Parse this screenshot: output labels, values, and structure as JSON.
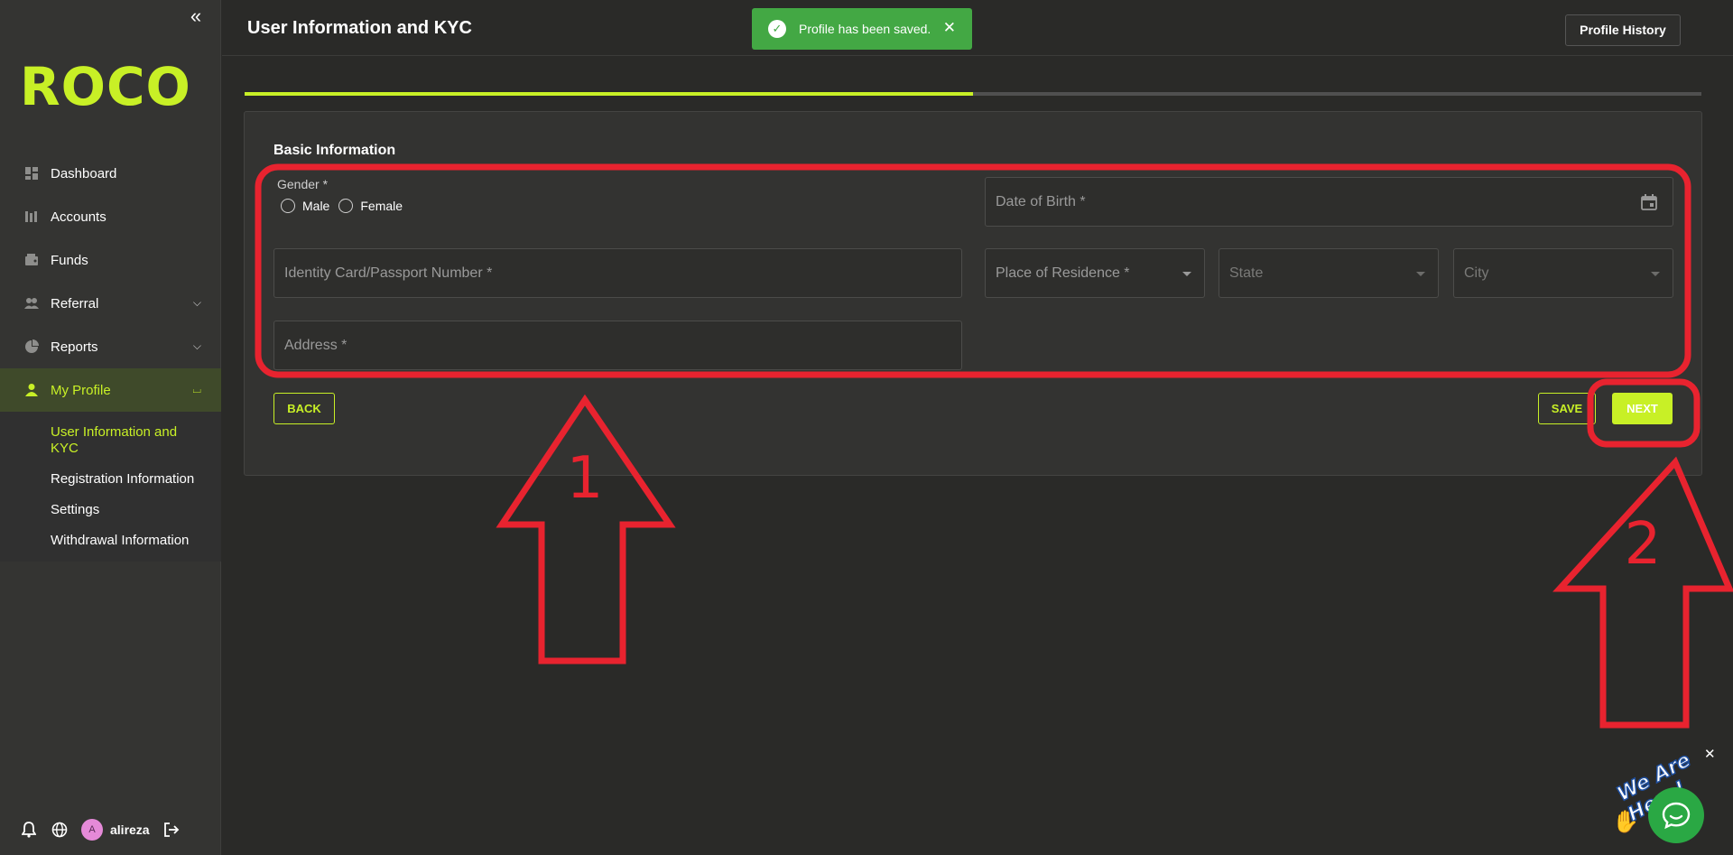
{
  "sidebar": {
    "logo": "ROCO",
    "nav": [
      {
        "label": "Dashboard",
        "icon": "dashboard-icon"
      },
      {
        "label": "Accounts",
        "icon": "accounts-icon"
      },
      {
        "label": "Funds",
        "icon": "wallet-icon"
      },
      {
        "label": "Referral",
        "icon": "users-icon",
        "expandable": true
      },
      {
        "label": "Reports",
        "icon": "pie-chart-icon",
        "expandable": true
      },
      {
        "label": "My Profile",
        "icon": "person-icon",
        "expandable": true,
        "active": true
      }
    ],
    "subnav": [
      {
        "label": "User Information and KYC",
        "active": true
      },
      {
        "label": "Registration Information"
      },
      {
        "label": "Settings"
      },
      {
        "label": "Withdrawal Information"
      }
    ],
    "footer": {
      "avatar_letter": "A",
      "username": "alireza"
    }
  },
  "header": {
    "title": "User Information and KYC",
    "history_button": "Profile History"
  },
  "toast": {
    "message": "Profile has been saved."
  },
  "progress": {
    "fraction": 0.5
  },
  "form": {
    "section_title": "Basic Information",
    "gender_label": "Gender *",
    "gender_options": [
      "Male",
      "Female"
    ],
    "date_of_birth": "Date of Birth *",
    "identity_number": "Identity Card/Passport Number *",
    "place_of_residence": "Place of Residence *",
    "state": "State",
    "city": "City",
    "address": "Address *"
  },
  "actions": {
    "back": "BACK",
    "save": "SAVE",
    "next": "NEXT"
  },
  "annotations": {
    "arrow_1": "1",
    "arrow_2": "2"
  },
  "chat_widget": {
    "tagline": "We Are Here!",
    "close": "✕"
  },
  "colors": {
    "accent": "#c8f026",
    "success": "#43a844",
    "annotation": "#e8232f"
  }
}
